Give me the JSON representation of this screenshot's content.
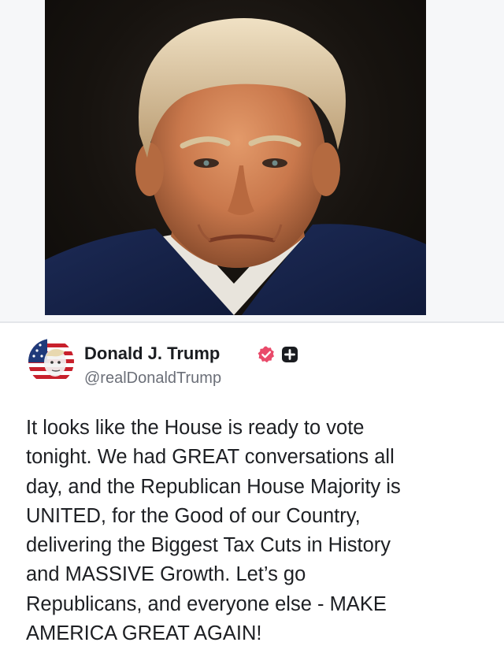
{
  "post": {
    "author_name": "Donald J. Trump",
    "handle": "@realDonaldTrump",
    "text": "It looks like the House is ready to vote\ntonight. We had GREAT conversations all\nday, and the Republican House Majority is\nUNITED, for the Good of our Country,\ndelivering the Biggest Tax Cuts in History\nand MASSIVE Growth. Let’s go\nRepublicans, and everyone else - MAKE\nAMERICA GREAT AGAIN!",
    "icons": {
      "verified": "verified-badge-icon",
      "plus": "plus-icon"
    }
  },
  "colors": {
    "verified_badge": "#e94a6a",
    "text_primary": "#1d1f23",
    "text_secondary": "#6b6f78"
  }
}
